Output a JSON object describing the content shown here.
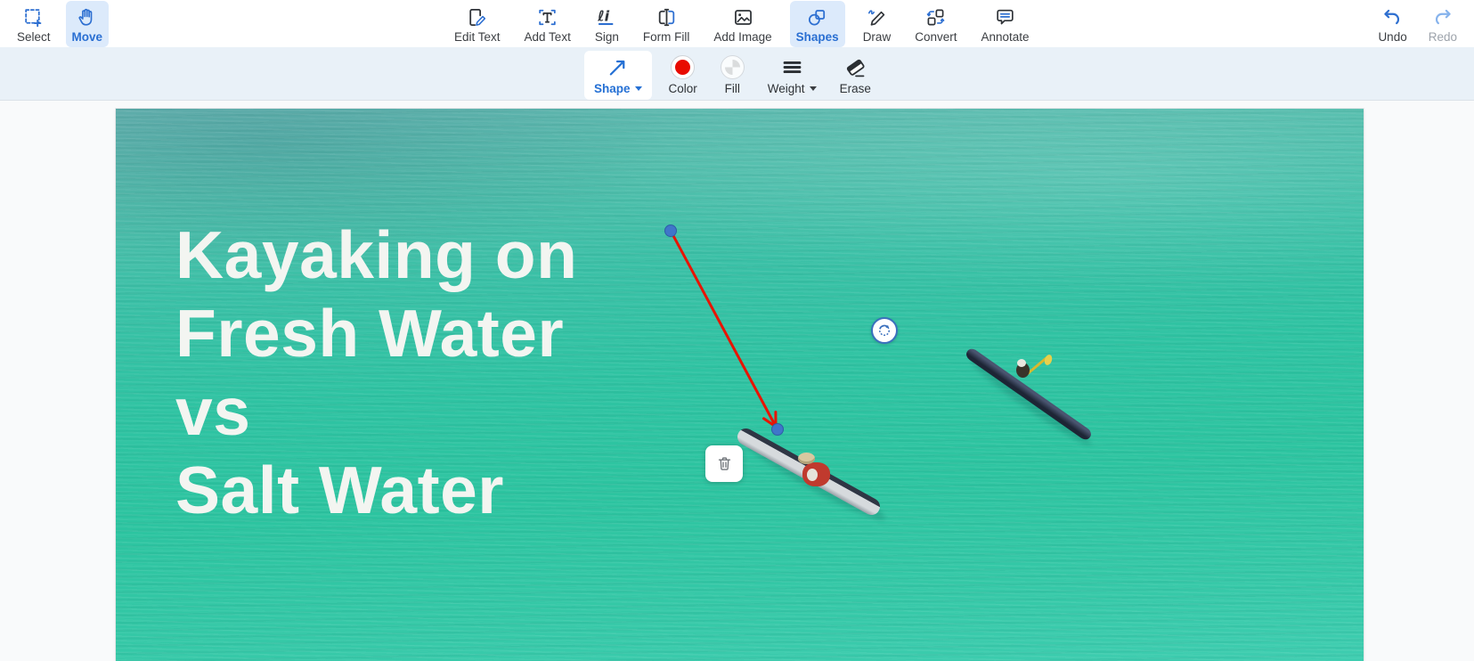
{
  "toolbar": {
    "left_items": [
      {
        "label": "Select",
        "icon": "select-marquee-icon",
        "active": false
      },
      {
        "label": "Move",
        "icon": "hand-icon",
        "active": true
      }
    ],
    "center_items": [
      {
        "label": "Edit Text",
        "icon": "edit-text-icon"
      },
      {
        "label": "Add Text",
        "icon": "add-text-icon"
      },
      {
        "label": "Sign",
        "icon": "signature-icon"
      },
      {
        "label": "Form Fill",
        "icon": "form-field-icon"
      },
      {
        "label": "Add Image",
        "icon": "image-icon"
      },
      {
        "label": "Shapes",
        "icon": "shapes-icon",
        "active": true
      },
      {
        "label": "Draw",
        "icon": "pencil-icon"
      },
      {
        "label": "Convert",
        "icon": "convert-icon"
      },
      {
        "label": "Annotate",
        "icon": "comment-icon"
      }
    ],
    "right_items": [
      {
        "label": "Undo",
        "icon": "undo-arrow-icon",
        "enabled": true
      },
      {
        "label": "Redo",
        "icon": "redo-arrow-icon",
        "enabled": false
      }
    ]
  },
  "shape_toolbar": {
    "shape_button": {
      "label": "Shape",
      "selected_shape": "arrow",
      "has_dropdown": true,
      "active": true
    },
    "color_button": {
      "label": "Color",
      "value": "#e80b00"
    },
    "fill_button": {
      "label": "Fill",
      "value": "transparent"
    },
    "weight_button": {
      "label": "Weight",
      "has_dropdown": true
    },
    "erase_button": {
      "label": "Erase"
    }
  },
  "document": {
    "title_lines": [
      "Kayaking on",
      "Fresh Water",
      "vs",
      "Salt Water"
    ]
  },
  "selection": {
    "type": "arrow-annotation",
    "stroke_color": "#e81403",
    "controls": [
      "start-handle",
      "end-handle",
      "rotate",
      "delete"
    ]
  },
  "colors": {
    "accent_blue": "#2a6fd2",
    "active_item_bg": "#dceafb",
    "shape_toolbar_bg": "#e9f1f8",
    "canvas_bg": "#f9fafb",
    "label_dark": "#3b3e42",
    "disabled_gray": "#9da3ab",
    "annotation_red": "#e81403",
    "handle_blue": "#3f76c9"
  }
}
